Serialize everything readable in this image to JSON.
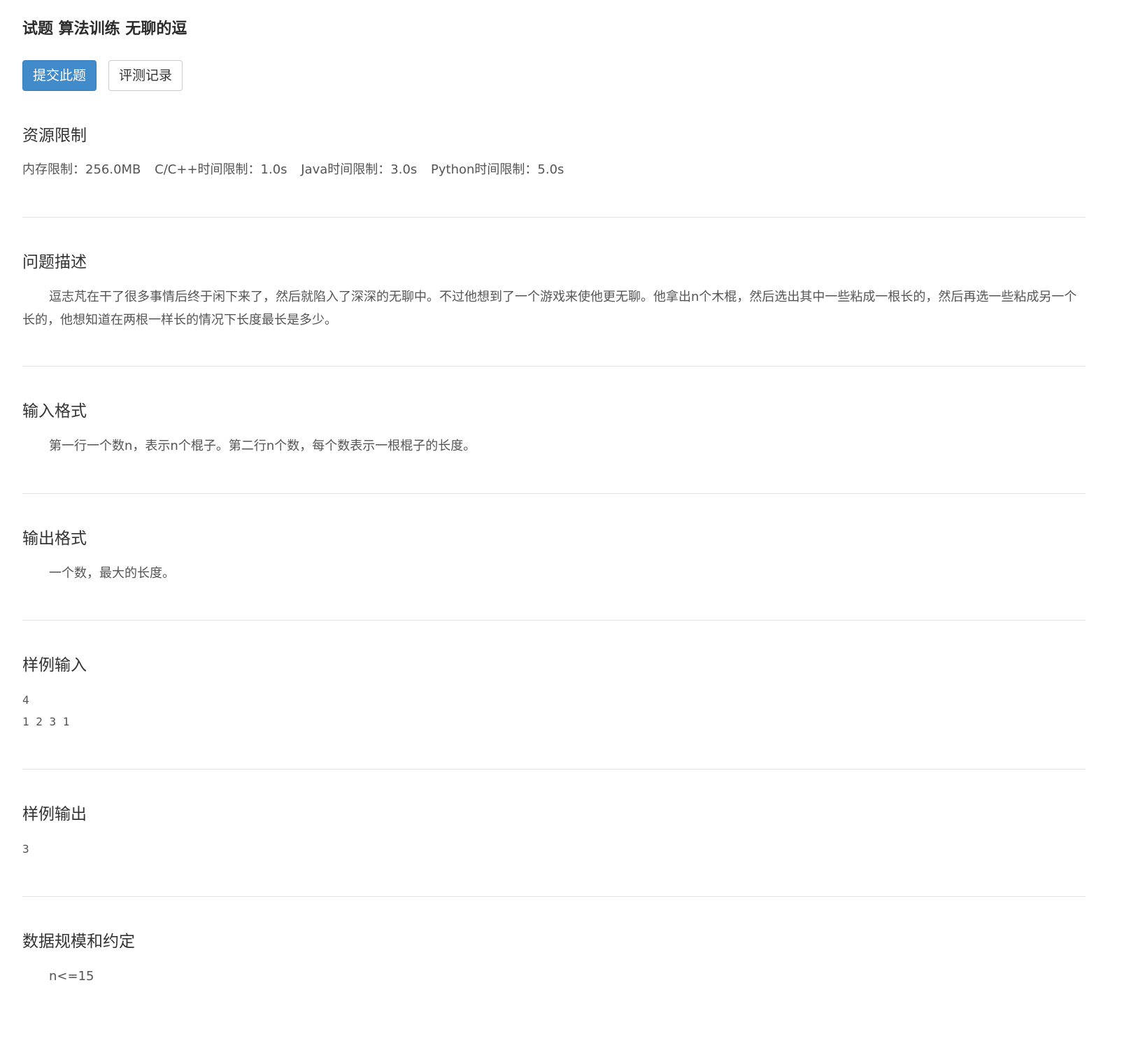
{
  "page": {
    "title": "试题 算法训练 无聊的逗"
  },
  "actions": {
    "submit_label": "提交此题",
    "records_label": "评测记录"
  },
  "resource": {
    "heading": "资源限制",
    "memory": "内存限制：256.0MB",
    "cpp_time": "C/C++时间限制：1.0s",
    "java_time": "Java时间限制：3.0s",
    "python_time": "Python时间限制：5.0s"
  },
  "description": {
    "heading": "问题描述",
    "text": "逗志芃在干了很多事情后终于闲下来了，然后就陷入了深深的无聊中。不过他想到了一个游戏来使他更无聊。他拿出n个木棍，然后选出其中一些粘成一根长的，然后再选一些粘成另一个长的，他想知道在两根一样长的情况下长度最长是多少。"
  },
  "input_format": {
    "heading": "输入格式",
    "text": "第一行一个数n，表示n个棍子。第二行n个数，每个数表示一根棍子的长度。"
  },
  "output_format": {
    "heading": "输出格式",
    "text": "一个数，最大的长度。"
  },
  "sample_input": {
    "heading": "样例输入",
    "lines": [
      "4",
      "1 2 3 1"
    ]
  },
  "sample_output": {
    "heading": "样例输出",
    "lines": [
      "3"
    ]
  },
  "constraints": {
    "heading": "数据规模和约定",
    "text": "n<=15"
  }
}
